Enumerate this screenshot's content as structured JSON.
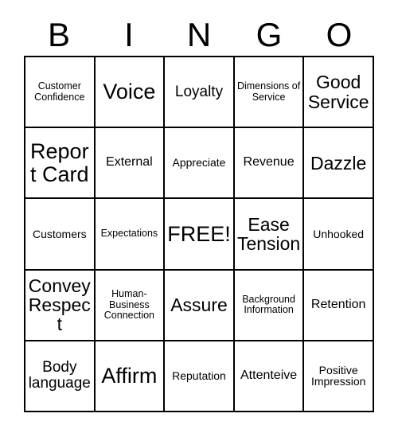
{
  "card": {
    "header_letters": [
      "B",
      "I",
      "N",
      "G",
      "O"
    ],
    "rows": [
      [
        {
          "text": "Customer Confidence",
          "size": "fs-xs"
        },
        {
          "text": "Voice",
          "size": "fs-xxl"
        },
        {
          "text": "Loyalty",
          "size": "fs-lg"
        },
        {
          "text": "Dimensions of Service",
          "size": "fs-xs"
        },
        {
          "text": "Good Service",
          "size": "fs-xl"
        }
      ],
      [
        {
          "text": "Report Card",
          "size": "fs-xxl"
        },
        {
          "text": "External",
          "size": "fs-md"
        },
        {
          "text": "Appreciate",
          "size": "fs-sm"
        },
        {
          "text": "Revenue",
          "size": "fs-md"
        },
        {
          "text": "Dazzle",
          "size": "fs-xl"
        }
      ],
      [
        {
          "text": "Customers",
          "size": "fs-sm"
        },
        {
          "text": "Expectations",
          "size": "fs-xs"
        },
        {
          "text": "FREE!",
          "size": "fs-xxl"
        },
        {
          "text": "Ease Tension",
          "size": "fs-xl"
        },
        {
          "text": "Unhooked",
          "size": "fs-sm"
        }
      ],
      [
        {
          "text": "Convey Respect",
          "size": "fs-xl"
        },
        {
          "text": "Human-Business Connection",
          "size": "fs-xs"
        },
        {
          "text": "Assure",
          "size": "fs-xl"
        },
        {
          "text": "Background Information",
          "size": "fs-xs"
        },
        {
          "text": "Retention",
          "size": "fs-md"
        }
      ],
      [
        {
          "text": "Body language",
          "size": "fs-lg"
        },
        {
          "text": "Affirm",
          "size": "fs-xxl"
        },
        {
          "text": "Reputation",
          "size": "fs-sm"
        },
        {
          "text": "Attenteive",
          "size": "fs-md"
        },
        {
          "text": "Positive Impression",
          "size": "fs-sm"
        }
      ]
    ]
  },
  "style": {
    "background_color": "#ffffff",
    "line_color": "#000000",
    "text_color": "#000000"
  }
}
